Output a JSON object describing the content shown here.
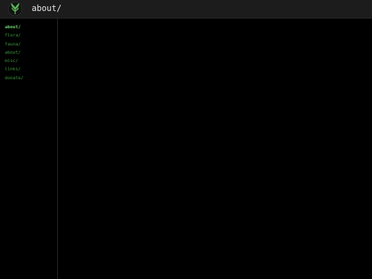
{
  "header": {
    "title": "about/",
    "logo_icon": "leaf-logo-icon"
  },
  "sidebar": {
    "active_index": 0,
    "items": [
      {
        "label": "about/"
      },
      {
        "label": "flora/"
      },
      {
        "label": "fauna/"
      },
      {
        "label": "about/"
      },
      {
        "label": "misc/"
      },
      {
        "label": "links/"
      },
      {
        "label": "donate/"
      }
    ]
  },
  "colors": {
    "background": "#000000",
    "header_bg": "#1c1c1c",
    "nav_link": "#3f9c3f",
    "nav_active": "#74d874",
    "title_text": "#e6e6e6"
  }
}
